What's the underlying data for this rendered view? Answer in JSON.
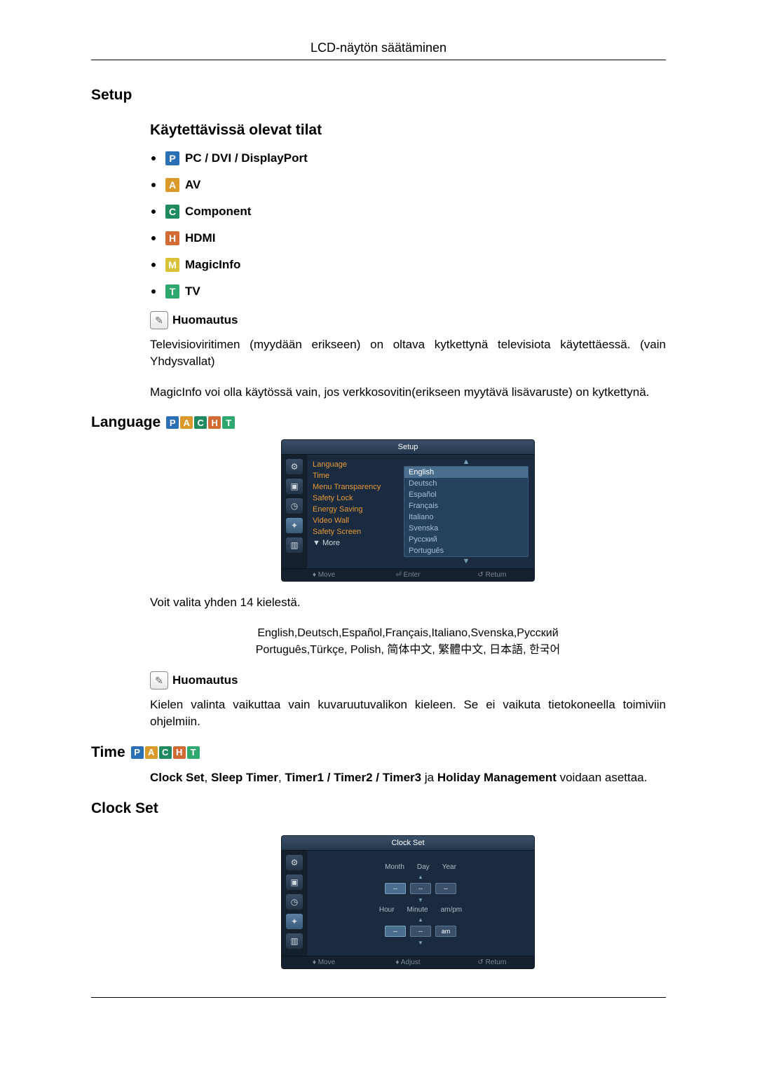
{
  "header": "LCD-näytön säätäminen",
  "sections": {
    "setup_title": "Setup",
    "modes_title": "Käytettävissä olevat tilat",
    "modes": [
      {
        "letter": "P",
        "cls": "mode-p",
        "label": "PC / DVI / DisplayPort"
      },
      {
        "letter": "A",
        "cls": "mode-a",
        "label": "AV"
      },
      {
        "letter": "C",
        "cls": "mode-c",
        "label": "Component"
      },
      {
        "letter": "H",
        "cls": "mode-h",
        "label": "HDMI"
      },
      {
        "letter": "M",
        "cls": "mode-m",
        "label": "MagicInfo"
      },
      {
        "letter": "T",
        "cls": "mode-t",
        "label": "TV"
      }
    ],
    "note_label": "Huomautus",
    "note1_para1": "Televisioviritimen (myydään erikseen) on oltava kytkettynä televisiota käytettäessä. (vain Yhdysvallat)",
    "note1_para2": "MagicInfo voi olla käytössä vain, jos verkkosovitin(erikseen myytävä lisävaruste) on kytket­tynä.",
    "language_title": "Language",
    "language_para": "Voit valita yhden 14 kielestä.",
    "languages_line1": "English,Deutsch,Español,Français,Italiano,Svenska,Русский",
    "languages_line2": "Português,Türkçe, Polish, 简体中文,  繁體中文, 日本語, 한국어",
    "note2_para": "Kielen valinta vaikuttaa vain kuvaruutuvalikon kieleen. Se ei vaikuta tietokoneella toimiviin ohjelmiin.",
    "time_title": "Time",
    "time_text_pre": "Clock Set",
    "time_text_b2": "Sleep Timer",
    "time_text_b3": "Timer1 / Timer2 / Timer3",
    "time_text_mid": " ja ",
    "time_text_b4": "Holiday Management",
    "time_text_post": " voidaan aset­taa.",
    "clockset_title": "Clock Set"
  },
  "osd_setup": {
    "title": "Setup",
    "menu": {
      "language": "Language",
      "time": "Time",
      "menu_transparency": "Menu Transparency",
      "safety_lock": "Safety Lock",
      "energy_saving": "Energy Saving",
      "video_wall": "Video Wall",
      "safety_screen": "Safety Screen",
      "more": "▼ More"
    },
    "langs": {
      "english": "English",
      "deutsch": "Deutsch",
      "espanol": "Español",
      "francais": "Français",
      "italiano": "Italiano",
      "svenska": "Svenska",
      "russian": "Русский",
      "portugues": "Português"
    },
    "footer": {
      "move": "Move",
      "enter": "Enter",
      "return": "Return"
    }
  },
  "osd_clock": {
    "title": "Clock Set",
    "labels": {
      "month": "Month",
      "day": "Day",
      "year": "Year",
      "hour": "Hour",
      "minute": "Minute",
      "ampm": "am/pm"
    },
    "values": {
      "month": "--",
      "day": "--",
      "year": "--",
      "hour": "--",
      "minute": "--",
      "ampm": "am"
    },
    "footer": {
      "move": "Move",
      "adjust": "Adjust",
      "return": "Return"
    }
  }
}
